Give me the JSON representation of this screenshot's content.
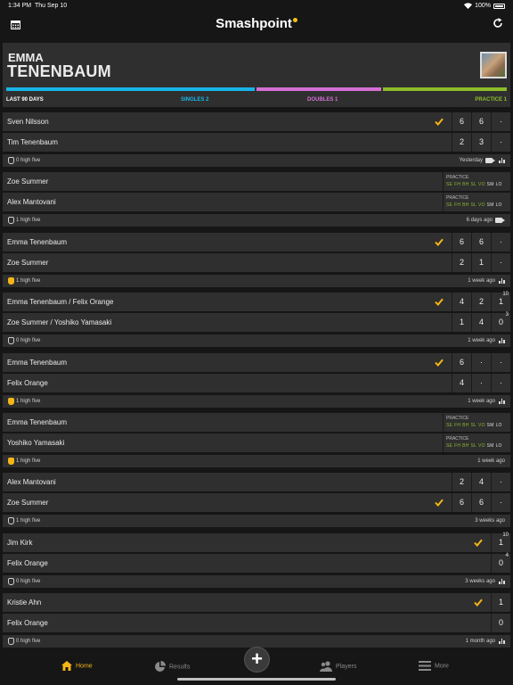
{
  "status_bar": {
    "time": "1:34 PM",
    "date": "Thu Sep 10",
    "battery": "100%"
  },
  "app": {
    "title": "Smashpoint"
  },
  "player": {
    "first_name": "EMMA",
    "last_name": "TENENBAUM",
    "period": "LAST 90 DAYS",
    "singles_label": "SINGLES 2",
    "doubles_label": "DOUBLES 1",
    "practice_label": "PRACTICE 1",
    "colors": {
      "singles": "#18b4e8",
      "doubles": "#d56fd6",
      "practice": "#8ebd2a"
    }
  },
  "matches": [
    {
      "type": "score",
      "p1": "Sven Nilsson",
      "p2": "Tim Tenenbaum",
      "winner": 1,
      "s1": [
        "6",
        "6",
        "·"
      ],
      "s2": [
        "2",
        "3",
        "·"
      ],
      "s1sup": [
        "",
        "",
        ""
      ],
      "s2sup": [
        "",
        "",
        ""
      ],
      "high_five": "0 high five",
      "high_five_on": false,
      "when": "Yesterday",
      "video": true,
      "stats": true
    },
    {
      "type": "practice",
      "p1": "Zoe Summer",
      "p2": "Alex Mantovani",
      "practice_title": "PRACTICE",
      "practice_codes": [
        "SE",
        "FH",
        "BH",
        "SL",
        "VO",
        "SM",
        "LO"
      ],
      "high_five": "1 high five",
      "high_five_on": false,
      "when": "6 days ago",
      "video": true,
      "stats": false
    },
    {
      "type": "score",
      "p1": "Emma Tenenbaum",
      "p2": "Zoe Summer",
      "winner": 1,
      "s1": [
        "6",
        "6",
        "·"
      ],
      "s2": [
        "2",
        "1",
        "·"
      ],
      "s1sup": [
        "",
        "",
        ""
      ],
      "s2sup": [
        "",
        "",
        ""
      ],
      "high_five": "1 high five",
      "high_five_on": true,
      "when": "1 week ago",
      "video": false,
      "stats": true
    },
    {
      "type": "score",
      "p1": "Emma Tenenbaum / Felix Orange",
      "p2": "Zoe Summer / Yoshiko Yamasaki",
      "winner": 1,
      "s1": [
        "4",
        "2",
        "1"
      ],
      "s2": [
        "1",
        "4",
        "0"
      ],
      "s1sup": [
        "",
        "",
        "10"
      ],
      "s2sup": [
        "",
        "",
        "3"
      ],
      "high_five": "0 high five",
      "high_five_on": false,
      "when": "1 week ago",
      "video": false,
      "stats": true
    },
    {
      "type": "score",
      "p1": "Emma Tenenbaum",
      "p2": "Felix Orange",
      "winner": 1,
      "s1": [
        "6",
        "·",
        "·"
      ],
      "s2": [
        "4",
        "·",
        "·"
      ],
      "s1sup": [
        "",
        "",
        ""
      ],
      "s2sup": [
        "",
        "",
        ""
      ],
      "high_five": "1 high five",
      "high_five_on": true,
      "when": "1 week ago",
      "video": false,
      "stats": true
    },
    {
      "type": "practice",
      "p1": "Emma Tenenbaum",
      "p2": "Yoshiko Yamasaki",
      "practice_title": "PRACTICE",
      "practice_codes": [
        "SE",
        "FH",
        "BH",
        "SL",
        "VO",
        "SM",
        "LO"
      ],
      "high_five": "1 high five",
      "high_five_on": true,
      "when": "1 week ago",
      "video": false,
      "stats": false
    },
    {
      "type": "score",
      "p1": "Alex Mantovani",
      "p2": "Zoe Summer",
      "winner": 2,
      "s1": [
        "2",
        "4",
        "·"
      ],
      "s2": [
        "6",
        "6",
        "·"
      ],
      "s1sup": [
        "",
        "",
        ""
      ],
      "s2sup": [
        "",
        "",
        ""
      ],
      "high_five": "1 high five",
      "high_five_on": false,
      "when": "3 weeks ago",
      "video": false,
      "stats": false
    },
    {
      "type": "score",
      "p1": "Jim Kirk",
      "p2": "Felix Orange",
      "winner": 1,
      "s1": [
        "1"
      ],
      "s2": [
        "0"
      ],
      "s1sup": [
        "10"
      ],
      "s2sup": [
        "4"
      ],
      "high_five": "0 high five",
      "high_five_on": false,
      "when": "3 weeks ago",
      "video": false,
      "stats": true
    },
    {
      "type": "score",
      "p1": "Kristie Ahn",
      "p2": "Felix Orange",
      "winner": 1,
      "s1": [
        "1"
      ],
      "s2": [
        "0"
      ],
      "s1sup": [
        ""
      ],
      "s2sup": [
        ""
      ],
      "high_five": "0 high five",
      "high_five_on": false,
      "when": "1 month ago",
      "video": false,
      "stats": true
    }
  ],
  "tabs": [
    {
      "label": "Home",
      "icon": "home-icon",
      "selected": true
    },
    {
      "label": "Results",
      "icon": "pie-chart-icon",
      "selected": false
    },
    {
      "label": "Players",
      "icon": "players-icon",
      "selected": false
    },
    {
      "label": "More",
      "icon": "menu-icon",
      "selected": false
    }
  ],
  "accent_color": "#f5b616",
  "add_button": "+"
}
